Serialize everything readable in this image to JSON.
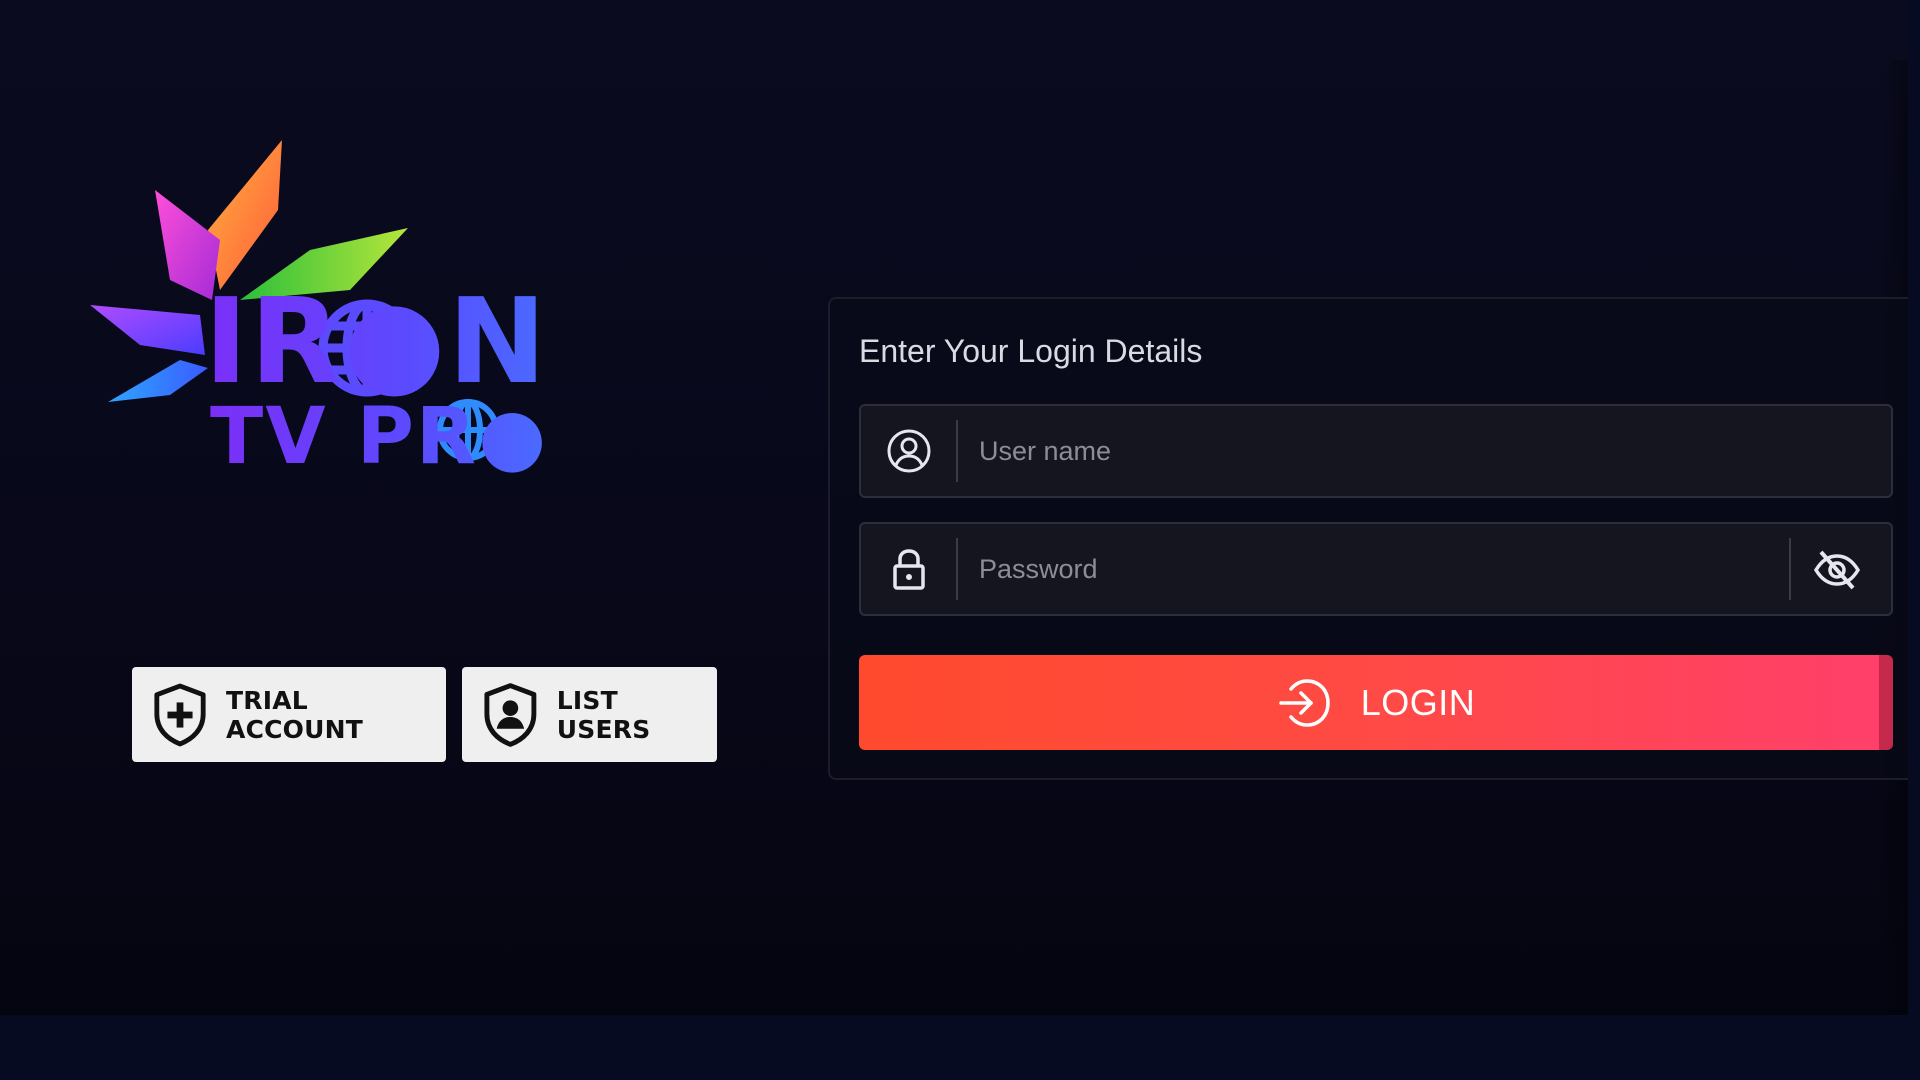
{
  "logo": {
    "line1": "IR●N",
    "line2": "TV PR●",
    "brand_text": "IRON TV PRO"
  },
  "side_buttons": {
    "trial_label": "TRIAL ACCOUNT",
    "trial_icon": "shield-plus-icon",
    "list_label": "LIST USERS",
    "list_icon": "shield-user-icon"
  },
  "login": {
    "title": "Enter Your Login Details",
    "username_placeholder": "User name",
    "username_value": "",
    "password_placeholder": "Password",
    "password_value": "",
    "username_icon": "user-circle-icon",
    "password_icon": "lock-icon",
    "toggle_icon": "eye-off-icon",
    "button_label": "LOGIN",
    "button_icon": "login-arrow-icon"
  },
  "colors": {
    "background": "#0a0b1f",
    "login_gradient_start": "#ff4a2e",
    "login_gradient_end": "#ff3f6b",
    "logo_purple": "#7b2ff7",
    "button_bg": "#efefef"
  }
}
